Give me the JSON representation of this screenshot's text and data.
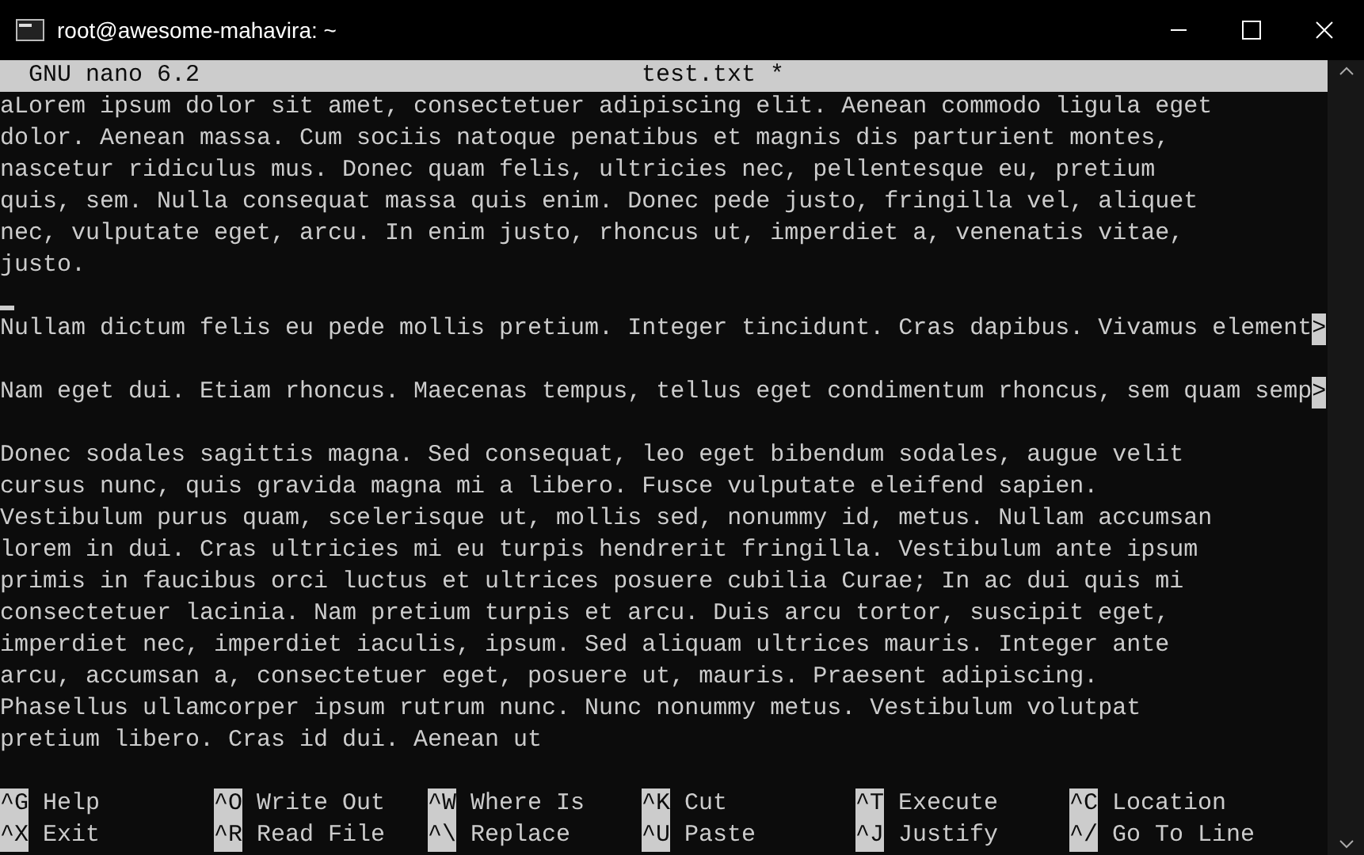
{
  "window": {
    "title": "root@awesome-mahavira: ~"
  },
  "header": {
    "version": "GNU nano 6.2",
    "filename": "test.txt *"
  },
  "lines": [
    {
      "kind": "text",
      "text": "aLorem ipsum dolor sit amet, consectetuer adipiscing elit. Aenean commodo ligula eget"
    },
    {
      "kind": "text",
      "text": "dolor. Aenean massa. Cum sociis natoque penatibus et magnis dis parturient montes,"
    },
    {
      "kind": "text",
      "text": "nascetur ridiculus mus. Donec quam felis, ultricies nec, pellentesque eu, pretium"
    },
    {
      "kind": "text",
      "text": "quis, sem. Nulla consequat massa quis enim. Donec pede justo, fringilla vel, aliquet"
    },
    {
      "kind": "text",
      "text": "nec, vulputate eget, arcu. In enim justo, rhoncus ut, imperdiet a, venenatis vitae,"
    },
    {
      "kind": "text",
      "text": "justo."
    },
    {
      "kind": "cursor"
    },
    {
      "kind": "text",
      "text": "Nullam dictum felis eu pede mollis pretium. Integer tincidunt. Cras dapibus. Vivamus element",
      "more": ">"
    },
    {
      "kind": "blank"
    },
    {
      "kind": "text",
      "text": "Nam eget dui. Etiam rhoncus. Maecenas tempus, tellus eget condimentum rhoncus, sem quam semp",
      "more": ">"
    },
    {
      "kind": "blank"
    },
    {
      "kind": "text",
      "text": "Donec sodales sagittis magna. Sed consequat, leo eget bibendum sodales, augue velit"
    },
    {
      "kind": "text",
      "text": "cursus nunc, quis gravida magna mi a libero. Fusce vulputate eleifend sapien."
    },
    {
      "kind": "text",
      "text": "Vestibulum purus quam, scelerisque ut, mollis sed, nonummy id, metus. Nullam accumsan"
    },
    {
      "kind": "text",
      "text": "lorem in dui. Cras ultricies mi eu turpis hendrerit fringilla. Vestibulum ante ipsum"
    },
    {
      "kind": "text",
      "text": "primis in faucibus orci luctus et ultrices posuere cubilia Curae; In ac dui quis mi"
    },
    {
      "kind": "text",
      "text": "consectetuer lacinia. Nam pretium turpis et arcu. Duis arcu tortor, suscipit eget,"
    },
    {
      "kind": "text",
      "text": "imperdiet nec, imperdiet iaculis, ipsum. Sed aliquam ultrices mauris. Integer ante"
    },
    {
      "kind": "text",
      "text": "arcu, accumsan a, consectetuer eget, posuere ut, mauris. Praesent adipiscing."
    },
    {
      "kind": "text",
      "text": "Phasellus ullamcorper ipsum rutrum nunc. Nunc nonummy metus. Vestibulum volutpat"
    },
    {
      "kind": "text",
      "text": "pretium libero. Cras id dui. Aenean ut"
    },
    {
      "kind": "blank"
    }
  ],
  "shortcuts": [
    [
      {
        "key": "^G",
        "label": "Help"
      },
      {
        "key": "^X",
        "label": "Exit"
      }
    ],
    [
      {
        "key": "^O",
        "label": "Write Out"
      },
      {
        "key": "^R",
        "label": "Read File"
      }
    ],
    [
      {
        "key": "^W",
        "label": "Where Is"
      },
      {
        "key": "^\\",
        "label": "Replace"
      }
    ],
    [
      {
        "key": "^K",
        "label": "Cut"
      },
      {
        "key": "^U",
        "label": "Paste"
      }
    ],
    [
      {
        "key": "^T",
        "label": "Execute"
      },
      {
        "key": "^J",
        "label": "Justify"
      }
    ],
    [
      {
        "key": "^C",
        "label": "Location"
      },
      {
        "key": "^/",
        "label": "Go To Line"
      }
    ]
  ]
}
